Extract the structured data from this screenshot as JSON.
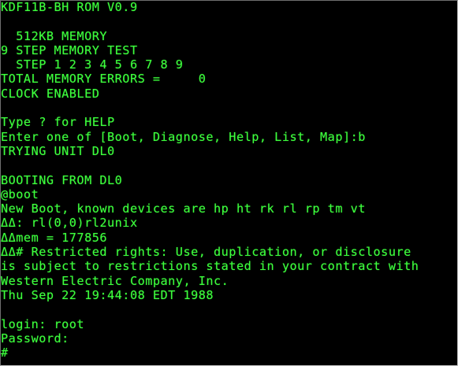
{
  "terminal": {
    "lines": [
      "KDF11B-BH ROM V0.9",
      "",
      "  512KB MEMORY",
      "9 STEP MEMORY TEST",
      "  STEP 1 2 3 4 5 6 7 8 9",
      "TOTAL MEMORY ERRORS =     0",
      "CLOCK ENABLED",
      "",
      "Type ? for HELP",
      "Enter one of [Boot, Diagnose, Help, List, Map]:b",
      "TRYING UNIT DL0",
      "",
      "BOOTING FROM DL0",
      "@boot",
      "New Boot, known devices are hp ht rk rl rp tm vt",
      "ΔΔ: rl(0,0)rl2unix",
      "ΔΔmem = 177856",
      "ΔΔ# Restricted rights: Use, duplication, or disclosure",
      "is subject to restrictions stated in your contract with",
      "Western Electric Company, Inc.",
      "Thu Sep 22 19:44:08 EDT 1988",
      "",
      "login: root",
      "Password:",
      "#"
    ]
  },
  "colors": {
    "foreground": "#3dff3d",
    "background": "#000000"
  }
}
